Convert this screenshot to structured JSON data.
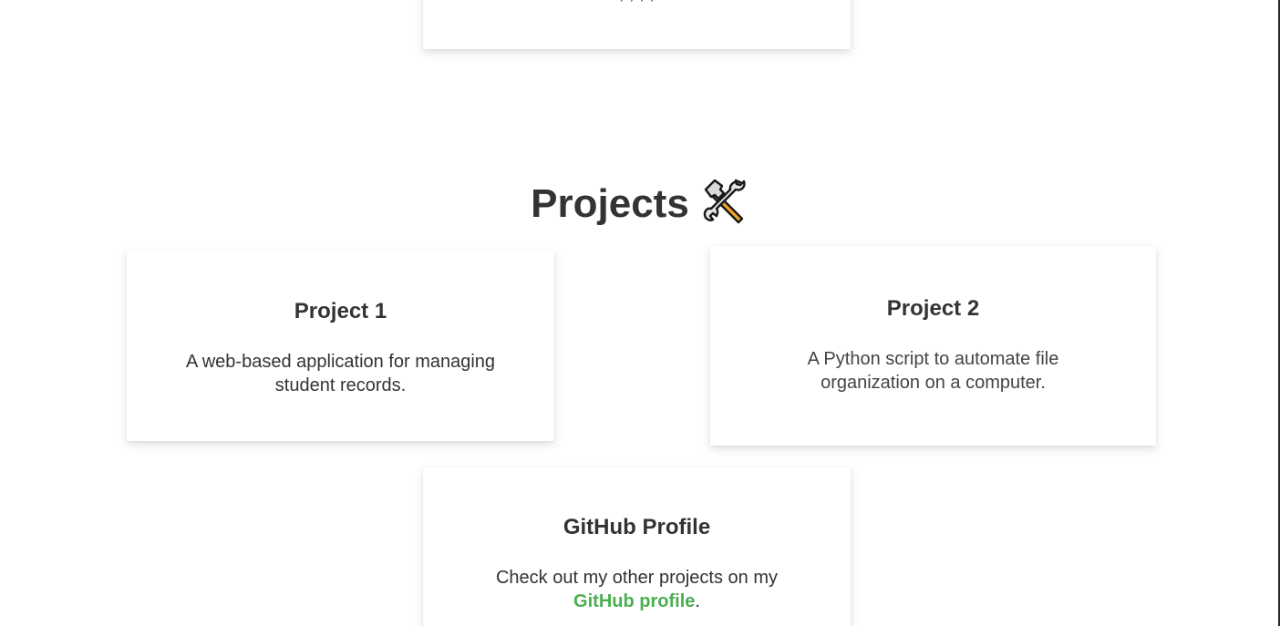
{
  "top_card": {
    "partial_text": ", , , ,"
  },
  "projects_section": {
    "title": "Projects",
    "icon": "hammer-and-wrench-icon"
  },
  "projects": [
    {
      "title": "Project 1",
      "description": "A web-based application for managing student records."
    },
    {
      "title": "Project 2",
      "description": "A Python script to automate file organization on a computer."
    }
  ],
  "github": {
    "title": "GitHub Profile",
    "text_before": "Check out my other projects on my",
    "link_label": "GitHub profile",
    "text_after": ".",
    "link_color": "#4caf50"
  }
}
